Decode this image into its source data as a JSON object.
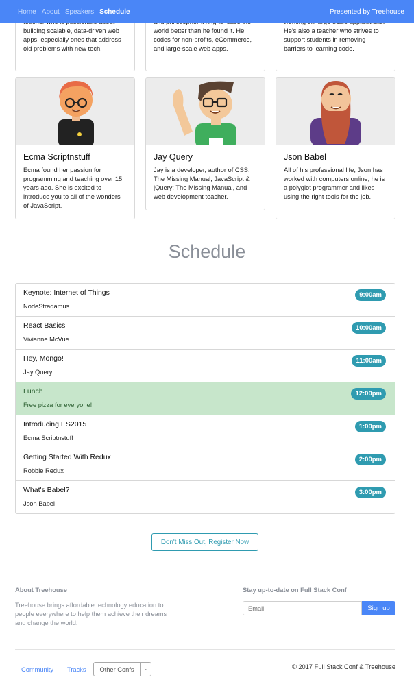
{
  "nav": {
    "links": [
      "Home",
      "About",
      "Speakers",
      "Schedule"
    ],
    "right": "Presented by Treehouse"
  },
  "top_cards": [
    {
      "text": "teacher who is passionate about building scalable, data-driven web apps, especially ones that address old problems with new tech!"
    },
    {
      "text": "and philosopher trying to leave the world better than he found it. He codes for non-profits, eCommerce, and large-scale web apps."
    },
    {
      "text": "working on large-scale applications. He's also a teacher who strives to support students in removing barriers to learning code."
    }
  ],
  "speakers": [
    {
      "name": "Ecma Scriptnstuff",
      "bio": "Ecma found her passion for programming and teaching over 15 years ago. She is excited to introduce you to all of the wonders of JavaScript."
    },
    {
      "name": "Jay Query",
      "bio": "Jay is a developer, author of CSS: The Missing Manual, JavaScript & jQuery: The Missing Manual, and web development teacher."
    },
    {
      "name": "Json Babel",
      "bio": "All of his professional life, Json has worked with computers online; he is a polyglot programmer and likes using the right tools for the job."
    }
  ],
  "schedule": {
    "title": "Schedule",
    "items": [
      {
        "title": "Keynote: Internet of Things",
        "speaker": "NodeStradamus",
        "time": "9:00am"
      },
      {
        "title": "React Basics",
        "speaker": "Vivianne McVue",
        "time": "10:00am"
      },
      {
        "title": "Hey, Mongo!",
        "speaker": "Jay Query",
        "time": "11:00am"
      },
      {
        "title": "Lunch",
        "speaker": "Free pizza for everyone!",
        "time": "12:00pm"
      },
      {
        "title": "Introducing ES2015",
        "speaker": "Ecma Scriptnstuff",
        "time": "1:00pm"
      },
      {
        "title": "Getting Started With Redux",
        "speaker": "Robbie Redux",
        "time": "2:00pm"
      },
      {
        "title": "What's Babel?",
        "speaker": "Json Babel",
        "time": "3:00pm"
      }
    ]
  },
  "register_label": "Don't Miss Out, Register Now",
  "footer": {
    "about_heading": "About Treehouse",
    "about_text": "Treehouse brings affordable technology education to people everywhere to help them achieve their dreams and change the world.",
    "stay_heading": "Stay up-to-date on Full Stack Conf",
    "email_placeholder": "Email",
    "signup_label": "Sign up",
    "community": "Community",
    "tracks": "Tracks",
    "other_confs": "Other Confs",
    "dropdown_caret": "-",
    "copyright": "© 2017 Full Stack Conf & Treehouse"
  },
  "colors": {
    "nav": "#4a86f7",
    "badge": "#2f9bb0",
    "lunch_row": "#c7e6cb"
  }
}
